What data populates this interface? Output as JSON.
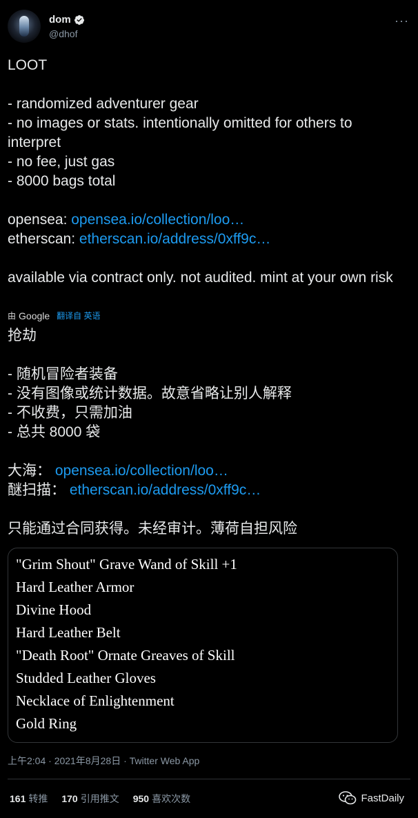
{
  "user": {
    "name": "dom",
    "handle": "@dhof",
    "more_label": "···"
  },
  "tweet": {
    "title": "LOOT",
    "bullets": [
      "- randomized adventurer gear",
      "- no images or stats. intentionally omitted for others to interpret",
      "- no fee, just gas",
      "- 8000 bags total"
    ],
    "opensea_label": "opensea: ",
    "opensea_link": "opensea.io/collection/loo…",
    "etherscan_label": "etherscan: ",
    "etherscan_link": "etherscan.io/address/0xff9c…",
    "footer": "available via contract only. not audited. mint at your own risk"
  },
  "translation": {
    "by_label": "由",
    "provider": "Google",
    "translated_from": "翻译自 英语",
    "title": "抢劫",
    "bullets": [
      "- 随机冒险者装备",
      "- 没有图像或统计数据。故意省略让别人解释",
      "- 不收费，只需加油",
      "- 总共 8000 袋"
    ],
    "opensea_label": "大海： ",
    "opensea_link": "opensea.io/collection/loo…",
    "etherscan_label": "醚扫描： ",
    "etherscan_link": "etherscan.io/address/0xff9c…",
    "footer": "只能通过合同获得。未经审计。薄荷自担风险"
  },
  "card": {
    "items": [
      "\"Grim Shout\" Grave Wand of Skill +1",
      "Hard Leather Armor",
      "Divine Hood",
      "Hard Leather Belt",
      "\"Death Root\" Ornate Greaves of Skill",
      "Studded Leather Gloves",
      "Necklace of Enlightenment",
      "Gold Ring"
    ]
  },
  "meta": "上午2:04 · 2021年8月28日 · Twitter Web App",
  "stats": [
    {
      "num": "161",
      "label": "转推"
    },
    {
      "num": "170",
      "label": "引用推文"
    },
    {
      "num": "950",
      "label": "喜欢次数"
    }
  ],
  "watermark": "FastDaily",
  "colors": {
    "link": "#1d9bf0",
    "verified": "#1d9bf0",
    "background": "#000000"
  }
}
